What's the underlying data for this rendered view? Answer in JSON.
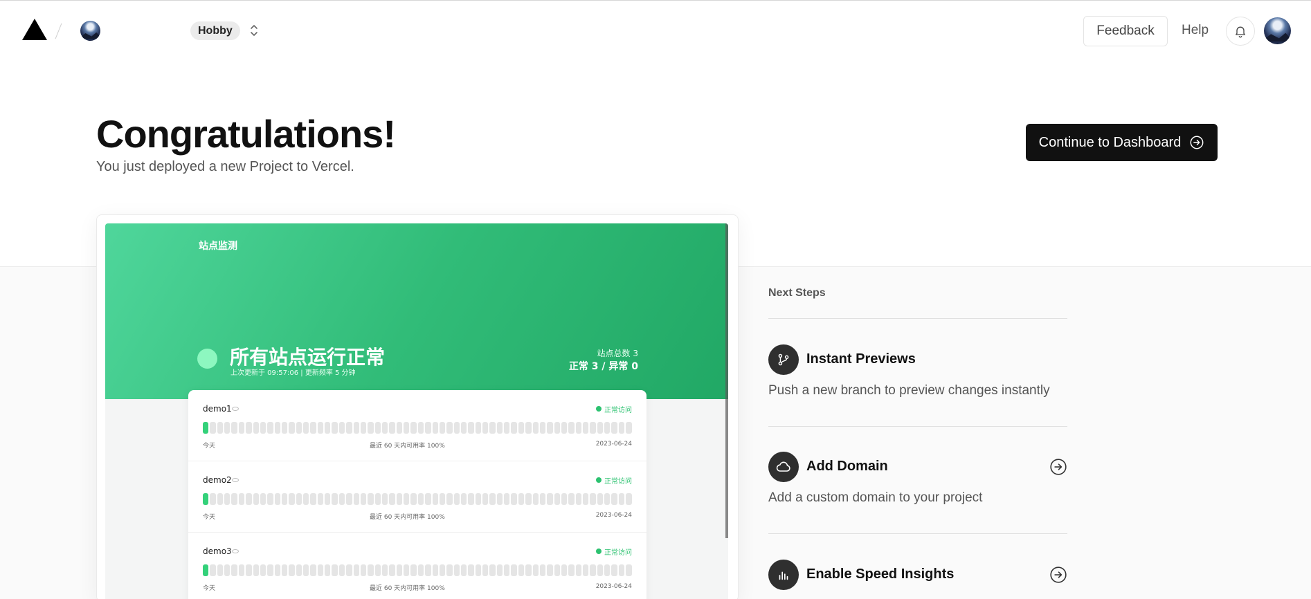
{
  "header": {
    "team_badge": "Hobby",
    "feedback_label": "Feedback",
    "help_label": "Help"
  },
  "hero": {
    "title": "Congratulations!",
    "subtitle": "You just deployed a new Project to Vercel.",
    "cta_label": "Continue to Dashboard"
  },
  "preview": {
    "site_title": "站点监测",
    "headline": "所有站点运行正常",
    "updated": "上次更新于 09:57:06 | 更新频率 5 分钟",
    "total_label": "站点总数 3",
    "summary": "正常 3 / 异常 0",
    "sites": [
      {
        "name": "demo1",
        "status": "正常访问",
        "left": "今天",
        "middle": "最近 60 天内可用率 100%",
        "right": "2023-06-24"
      },
      {
        "name": "demo2",
        "status": "正常访问",
        "left": "今天",
        "middle": "最近 60 天内可用率 100%",
        "right": "2023-06-24"
      },
      {
        "name": "demo3",
        "status": "正常访问",
        "left": "今天",
        "middle": "最近 60 天内可用率 100%",
        "right": "2023-06-24"
      }
    ]
  },
  "next_steps": {
    "heading": "Next Steps",
    "items": [
      {
        "title": "Instant Previews",
        "description": "Push a new branch to preview changes instantly",
        "icon": "git-branch-icon"
      },
      {
        "title": "Add Domain",
        "description": "Add a custom domain to your project",
        "icon": "cloud-icon"
      },
      {
        "title": "Enable Speed Insights",
        "description": "",
        "icon": "bar-chart-icon"
      }
    ]
  },
  "colors": {
    "accent_dark": "#111111",
    "hero_green": "#31bc78",
    "status_green": "#2cc270"
  }
}
